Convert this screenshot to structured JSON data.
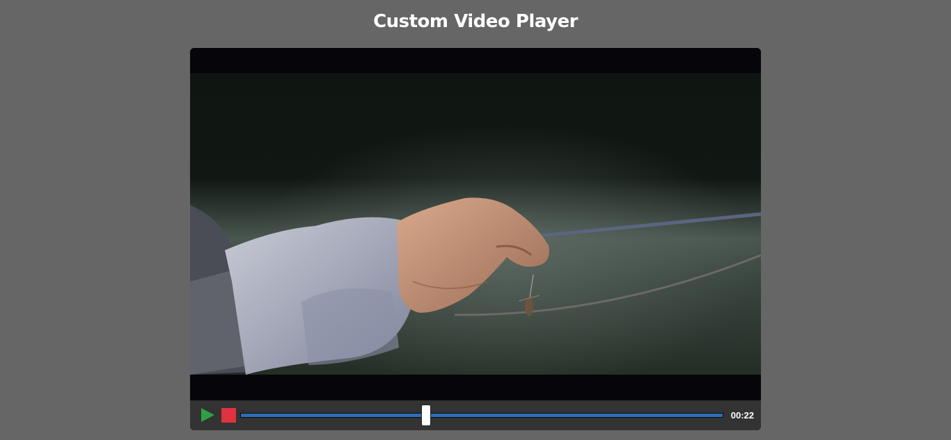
{
  "page": {
    "title": "Custom Video Player"
  },
  "player": {
    "controls": {
      "play_icon": "play-icon",
      "stop_icon": "stop-icon",
      "progress_fraction": 0.385,
      "time_display": "00:22"
    }
  },
  "colors": {
    "background": "#666666",
    "controls_bar": "#333333",
    "play": "#2ea043",
    "stop": "#e0323f",
    "progress": "#2b6fb6",
    "thumb": "#ffffff"
  }
}
